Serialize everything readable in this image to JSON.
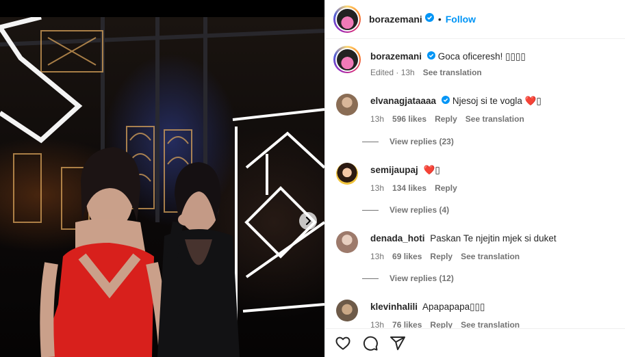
{
  "post": {
    "username": "borazemani",
    "follow_label": "Follow",
    "separator": "•",
    "caption_text": "Goca oficeresh! ▯▯▯▯",
    "caption_meta_edited": "Edited · 13h",
    "caption_meta_translate": "See translation"
  },
  "media": {
    "next_icon": "chevron-right-icon"
  },
  "comments": [
    {
      "username": "elvanagjataaaa",
      "verified": true,
      "text": "Njesoj si te vogla ❤️▯",
      "time": "13h",
      "likes": "596 likes",
      "reply": "Reply",
      "translate": "See translation",
      "view_replies": "View replies (23)"
    },
    {
      "username": "semijaupaj",
      "verified": false,
      "text": "❤️▯",
      "time": "13h",
      "likes": "134 likes",
      "reply": "Reply",
      "translate": "",
      "view_replies": "View replies (4)"
    },
    {
      "username": "denada_hoti",
      "verified": false,
      "text": "Paskan Te njejtin mjek si duket",
      "time": "13h",
      "likes": "69 likes",
      "reply": "Reply",
      "translate": "See translation",
      "view_replies": "View replies (12)"
    },
    {
      "username": "klevinhalili",
      "verified": false,
      "text": "Apapapapa▯▯▯",
      "time": "13h",
      "likes": "76 likes",
      "reply": "Reply",
      "translate": "See translation",
      "view_replies": ""
    }
  ],
  "footer": {
    "icons": [
      "heart-icon",
      "comment-icon",
      "share-icon"
    ]
  },
  "colors": {
    "accent": "#0095f6",
    "text": "#262626",
    "muted": "#737373",
    "border": "#efefef",
    "dress_red": "#d8201c"
  }
}
